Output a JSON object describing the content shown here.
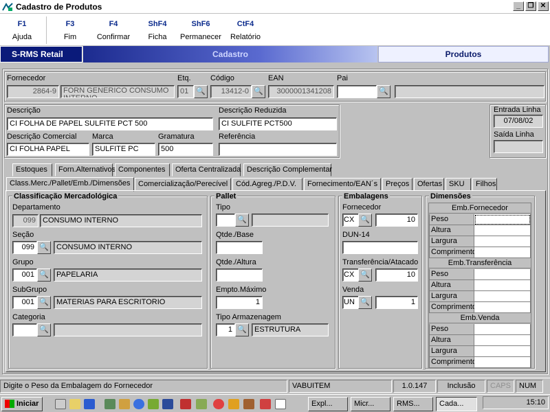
{
  "window": {
    "title": "Cadastro de Produtos"
  },
  "fkeys": [
    {
      "key": "F1",
      "label": "Ajuda"
    },
    {
      "key": "F3",
      "label": "Fim"
    },
    {
      "key": "F4",
      "label": "Confirmar"
    },
    {
      "key": "ShF4",
      "label": "Ficha"
    },
    {
      "key": "ShF6",
      "label": "Permanecer"
    },
    {
      "key": "CtF4",
      "label": "Relatório"
    }
  ],
  "banner": {
    "app": "S-RMS Retail",
    "section": "Cadastro",
    "module": "Produtos"
  },
  "header": {
    "fornecedor": {
      "label": "Fornecedor",
      "code": "2864-9",
      "name": "FORN GENERICO CONSUMO INTERNO"
    },
    "etq": {
      "label": "Etq.",
      "value": "01"
    },
    "codigo": {
      "label": "Código",
      "value": "13412-0"
    },
    "ean": {
      "label": "EAN",
      "value": "3000001341208"
    },
    "pai": {
      "label": "Pai",
      "value": "",
      "name": ""
    }
  },
  "desc": {
    "descricao": {
      "label": "Descrição",
      "value": "CI FOLHA DE PAPEL SULFITE PCT 500"
    },
    "reduzida": {
      "label": "Descrição Reduzida",
      "value": "CI SULFITE PCT500"
    },
    "comercial": {
      "label": "Descrição Comercial",
      "value": "CI FOLHA PAPEL"
    },
    "marca": {
      "label": "Marca",
      "value": "SULFITE PC"
    },
    "gramatura": {
      "label": "Gramatura",
      "value": "500"
    },
    "referencia": {
      "label": "Referência",
      "value": ""
    }
  },
  "linha": {
    "entrada_label": "Entrada Linha",
    "entrada": "07/08/02",
    "saida_label": "Saída Linha",
    "saida": ""
  },
  "tabs_row1": [
    "Estoques",
    "Forn.Alternativos",
    "Componentes",
    "Oferta Centralizada",
    "Descrição Complementar"
  ],
  "tabs_row2": [
    "Class.Merc./Pallet/Emb./Dimensões",
    "Comercialização/Perecível",
    "Cód.Agreg./P.D.V.",
    "Fornecimento/EAN´s",
    "Preços",
    "Ofertas",
    "SKU",
    "Filhos"
  ],
  "classificacao": {
    "title": "Classificação Mercadológica",
    "departamento": {
      "label": "Departamento",
      "code": "099",
      "name": "CONSUMO INTERNO"
    },
    "secao": {
      "label": "Seção",
      "code": "099",
      "name": "CONSUMO INTERNO"
    },
    "grupo": {
      "label": "Grupo",
      "code": "001",
      "name": "PAPELARIA"
    },
    "subgrupo": {
      "label": "SubGrupo",
      "code": "001",
      "name": "MATERIAS PARA ESCRITORIO"
    },
    "categoria": {
      "label": "Categoria",
      "code": "",
      "name": ""
    }
  },
  "pallet": {
    "title": "Pallet",
    "tipo": {
      "label": "Tipo",
      "code": "",
      "name": ""
    },
    "qtde_base": {
      "label": "Qtde./Base",
      "value": ""
    },
    "qtde_altura": {
      "label": "Qtde./Altura",
      "value": ""
    },
    "empto": {
      "label": "Empto.Máximo",
      "value": "1"
    },
    "armazenagem": {
      "label": "Tipo Armazenagem",
      "code": "1",
      "name": "ESTRUTURA"
    }
  },
  "embalagens": {
    "title": "Embalagens",
    "fornecedor": {
      "label": "Fornecedor",
      "unit": "CX",
      "value": "10"
    },
    "dun": {
      "label": "DUN-14",
      "value": ""
    },
    "transferencia": {
      "label": "Transferência/Atacado",
      "unit": "CX",
      "value": "10"
    },
    "venda": {
      "label": "Venda",
      "unit": "UN",
      "value": "1"
    }
  },
  "dimensoes": {
    "title": "Dimensões",
    "groups": [
      "Emb.Fornecedor",
      "Emb.Transferência",
      "Emb.Venda"
    ],
    "rows": [
      "Peso",
      "Altura",
      "Largura",
      "Comprimento"
    ]
  },
  "status": {
    "message": "Digite o Peso da Embalagem do Fornecedor",
    "user": "VABUITEM",
    "version": "1.0.147",
    "mode": "Inclusão",
    "caps": "CAPS",
    "num": "NUM"
  },
  "taskbar": {
    "start": "Iniciar",
    "items": [
      "Expl...",
      "Micr...",
      "RMS...",
      "Cada..."
    ],
    "clock": "15:10"
  }
}
